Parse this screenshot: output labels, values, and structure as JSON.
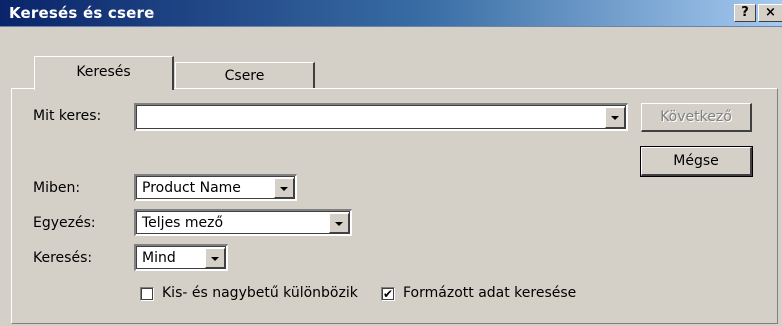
{
  "window": {
    "title": "Keresés és csere",
    "help_label": "?",
    "close_label": "×"
  },
  "tabs": [
    {
      "label": "Keresés",
      "selected": true
    },
    {
      "label": "Csere",
      "selected": false
    }
  ],
  "find_what": {
    "label": "Mit keres:",
    "value": ""
  },
  "look_in": {
    "label": "Miben:",
    "value": "Product Name"
  },
  "match": {
    "label": "Egyezés:",
    "value": "Teljes mező"
  },
  "search": {
    "label": "Keresés:",
    "value": "Mind"
  },
  "buttons": {
    "find_next": "Következő",
    "cancel": "Mégse"
  },
  "options": {
    "match_case": {
      "label": "Kis- és nagybetű különbözik",
      "checked": false
    },
    "search_formatted": {
      "label": "Formázott adat keresése",
      "checked": true
    }
  }
}
